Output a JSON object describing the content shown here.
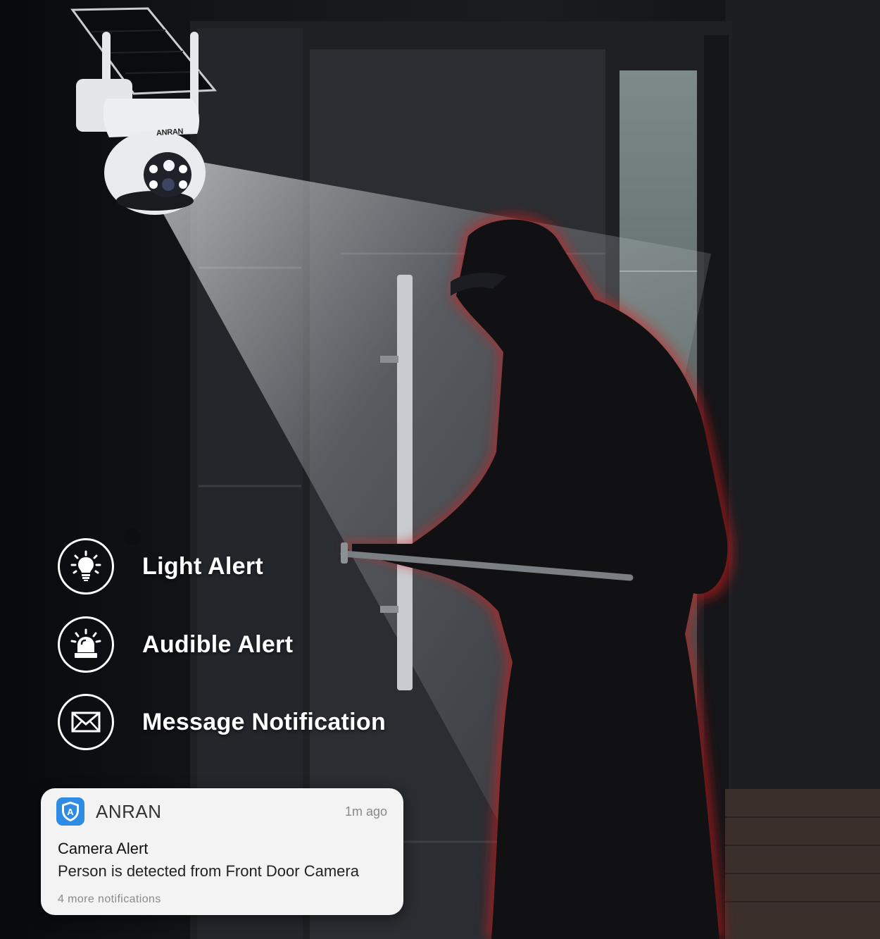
{
  "camera": {
    "brand_mark": "ANRAN"
  },
  "features": [
    {
      "label": "Light Alert",
      "icon": "light-bulb-icon"
    },
    {
      "label": "Audible Alert",
      "icon": "siren-icon"
    },
    {
      "label": "Message Notification",
      "icon": "envelope-icon"
    }
  ],
  "notification": {
    "app_name": "ANRAN",
    "app_icon": "shield-a-icon",
    "time": "1m ago",
    "title": "Camera Alert",
    "body": "Person is detected from Front Door Camera",
    "more": "4 more notifications"
  },
  "colors": {
    "alert_glow": "#d81f1f",
    "notification_bg": "#f3f3f4",
    "app_icon_bg": "#2f8ce5"
  }
}
